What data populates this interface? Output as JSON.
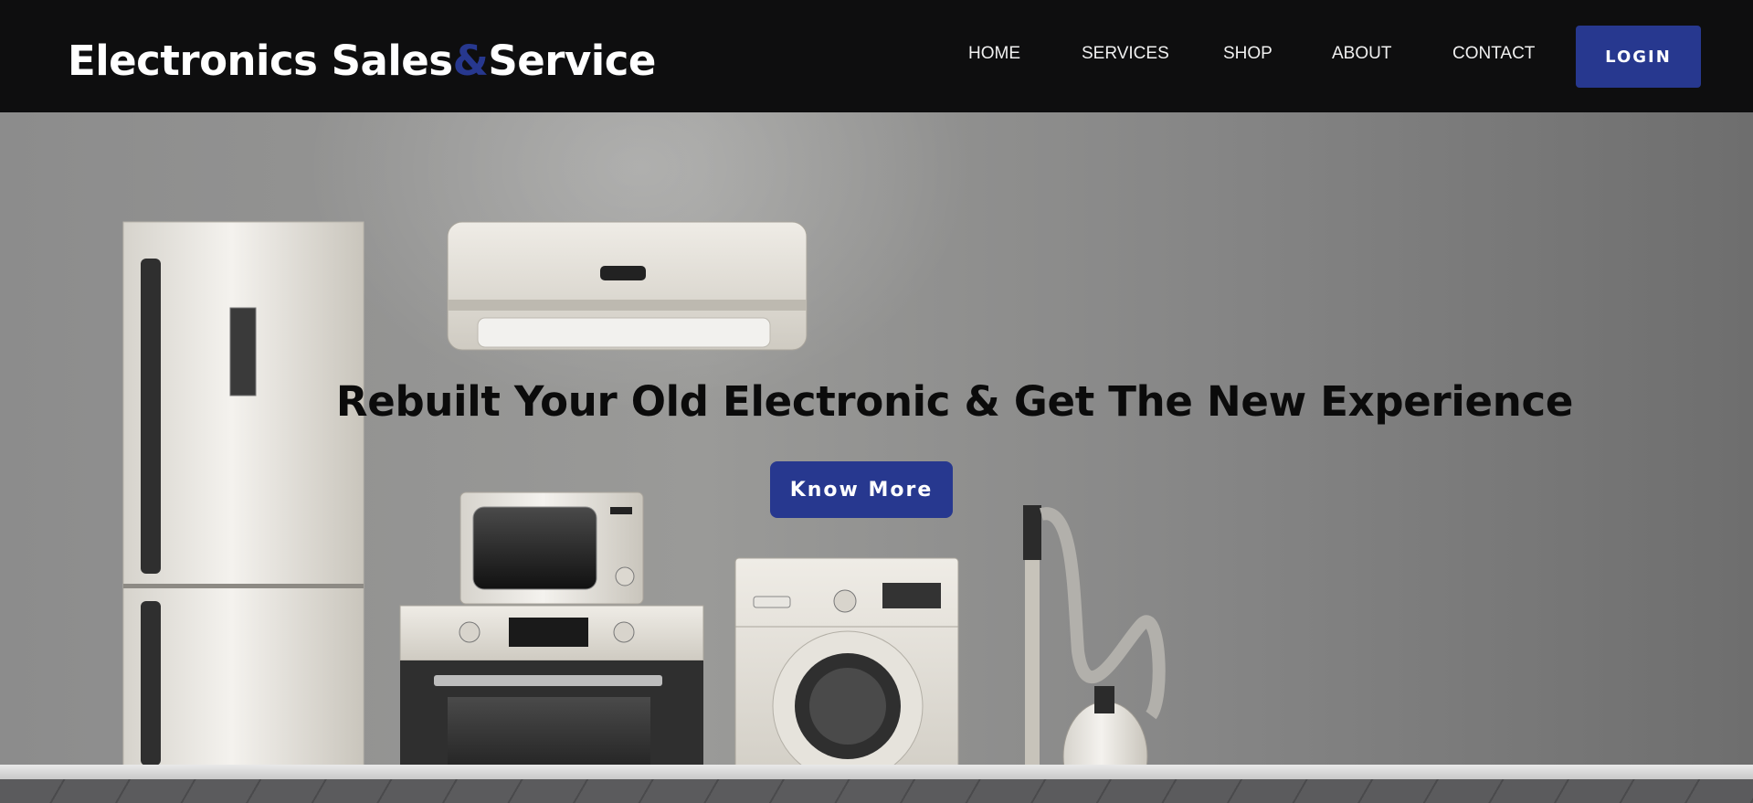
{
  "header": {
    "brand": {
      "part1": "Electronics Sales",
      "amp": "&",
      "part2": "Service"
    },
    "nav": [
      "HOME",
      "SERVICES",
      "SHOP",
      "ABOUT",
      "CONTACT"
    ],
    "login_label": "LOGIN"
  },
  "hero": {
    "headline": "Rebuilt Your Old Electronic & Get The New Experience",
    "cta_label": "Know More"
  },
  "colors": {
    "accent": "#27388f",
    "header_bg": "#0e0e0f",
    "text_dark": "#0b0b0b"
  },
  "illustration": [
    "refrigerator-icon",
    "air-conditioner-icon",
    "microwave-icon",
    "oven-icon",
    "washing-machine-icon",
    "vacuum-cleaner-icon"
  ]
}
